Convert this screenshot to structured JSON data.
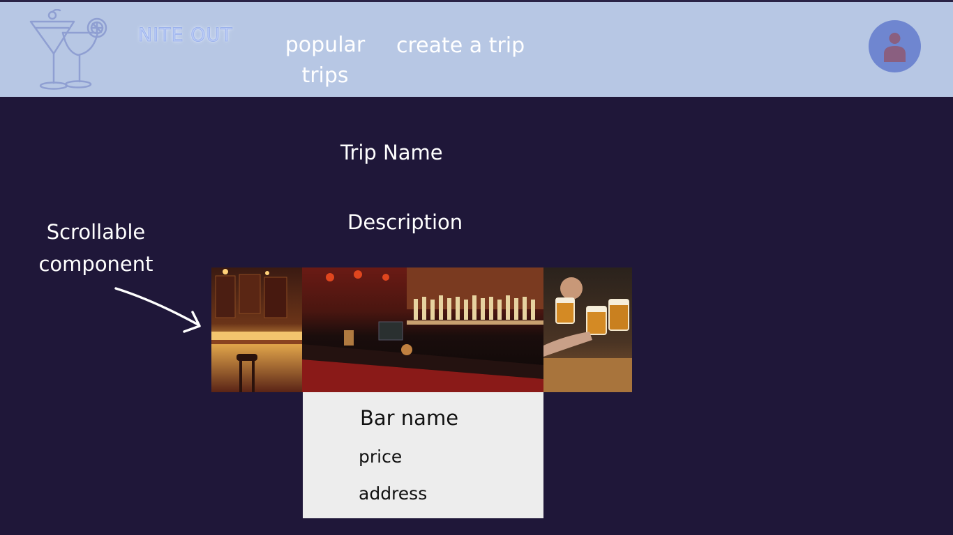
{
  "header": {
    "brand": "NITE OUT",
    "nav": {
      "popular_trips": "popular trips",
      "create_trip": "create a trip"
    },
    "logo_icon": "cocktail-glasses-icon",
    "avatar_icon": "user-avatar-icon"
  },
  "main": {
    "trip_name": "Trip Name",
    "description": "Description",
    "annotation": "Scrollable component",
    "gallery": {
      "images": [
        "bar-interior-photo",
        "bar-counter-photo",
        "beer-toast-photo"
      ]
    },
    "card": {
      "bar_name": "Bar name",
      "price": "price",
      "address": "address"
    }
  },
  "colors": {
    "background": "#1f1739",
    "header": "#b7c7e4",
    "avatar": "#6f86d0",
    "card": "#ededed"
  }
}
